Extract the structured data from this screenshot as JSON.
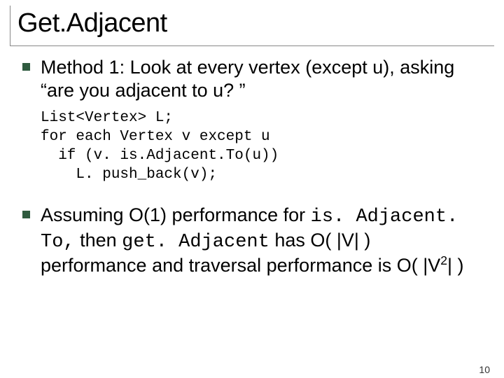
{
  "title": "Get.Adjacent",
  "bullets": [
    {
      "text_parts": [
        {
          "t": "Method 1:  Look at every vertex (except u), asking “are you adjacent to u? ”",
          "mono": false
        }
      ],
      "code": "List<Vertex> L;\nfor each Vertex v except u\n  if (v. is.Adjacent.To(u))\n    L. push_back(v);"
    },
    {
      "text_parts": [
        {
          "t": "Assuming O(1) performance for ",
          "mono": false
        },
        {
          "t": "is. Adjacent. To,",
          "mono": true
        },
        {
          "t": " then ",
          "mono": false
        },
        {
          "t": "get. Adjacent",
          "mono": true
        },
        {
          "t": " has O( |V| ) performance and traversal performance is O( |V",
          "mono": false
        },
        {
          "t": "2",
          "mono": false,
          "sup": true
        },
        {
          "t": "| )",
          "mono": false
        }
      ]
    }
  ],
  "page_number": "10"
}
